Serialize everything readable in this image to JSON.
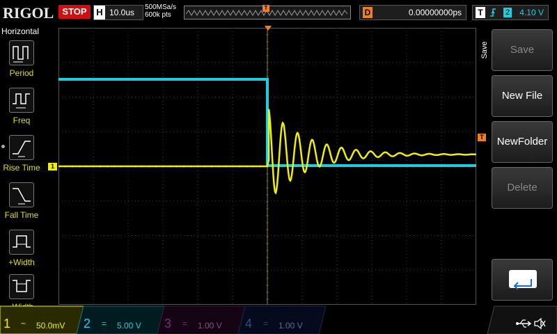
{
  "header": {
    "brand": "RIGOL",
    "run_state": "STOP",
    "timebase_label": "H",
    "timebase_value": "10.0us",
    "sample_rate": "500MSa/s",
    "memory_depth": "600k pts",
    "trigger_marker": "T",
    "delay_label": "D",
    "delay_value": "0.00000000ps",
    "trigger_label": "T",
    "trigger_source": "2",
    "trigger_level": "4.10 V"
  },
  "left_menu": {
    "title": "Horizontal",
    "items": [
      {
        "label": "Period",
        "icon": "period-icon"
      },
      {
        "label": "Freq",
        "icon": "frequency-icon"
      },
      {
        "label": "Rise Time",
        "icon": "rise-time-icon"
      },
      {
        "label": "Fall Time",
        "icon": "fall-time-icon"
      },
      {
        "label": "+Width",
        "icon": "positive-width-icon"
      },
      {
        "label": "-Width",
        "icon": "negative-width-icon"
      }
    ]
  },
  "right_menu": {
    "tab": "Save",
    "buttons": [
      {
        "label": "Save",
        "enabled": false
      },
      {
        "label": "New File",
        "enabled": true
      },
      {
        "label": "NewFolder",
        "enabled": true
      },
      {
        "label": "Delete",
        "enabled": false
      }
    ],
    "enter_icon": "enter-return-icon"
  },
  "markers": {
    "ch1": "1",
    "trigger_level": "T"
  },
  "channels": [
    {
      "num": "1",
      "coupling": "~",
      "scale": "50.0mV",
      "color": "#f0f000",
      "active": true
    },
    {
      "num": "2",
      "coupling": "=",
      "scale": "5.00 V",
      "color": "#1ad0e0",
      "active": true
    },
    {
      "num": "3",
      "coupling": "=",
      "scale": "1.00 V",
      "color": "#c040c0",
      "active": false
    },
    {
      "num": "4",
      "coupling": "=",
      "scale": "1.00 V",
      "color": "#2060e0",
      "active": false
    }
  ],
  "status_icons": [
    "usb-icon",
    "sound-muted-icon"
  ],
  "colors": {
    "ch1": "#f0f000",
    "ch2": "#1ad0e0",
    "stop": "#d01010",
    "delay": "#f08020"
  }
}
